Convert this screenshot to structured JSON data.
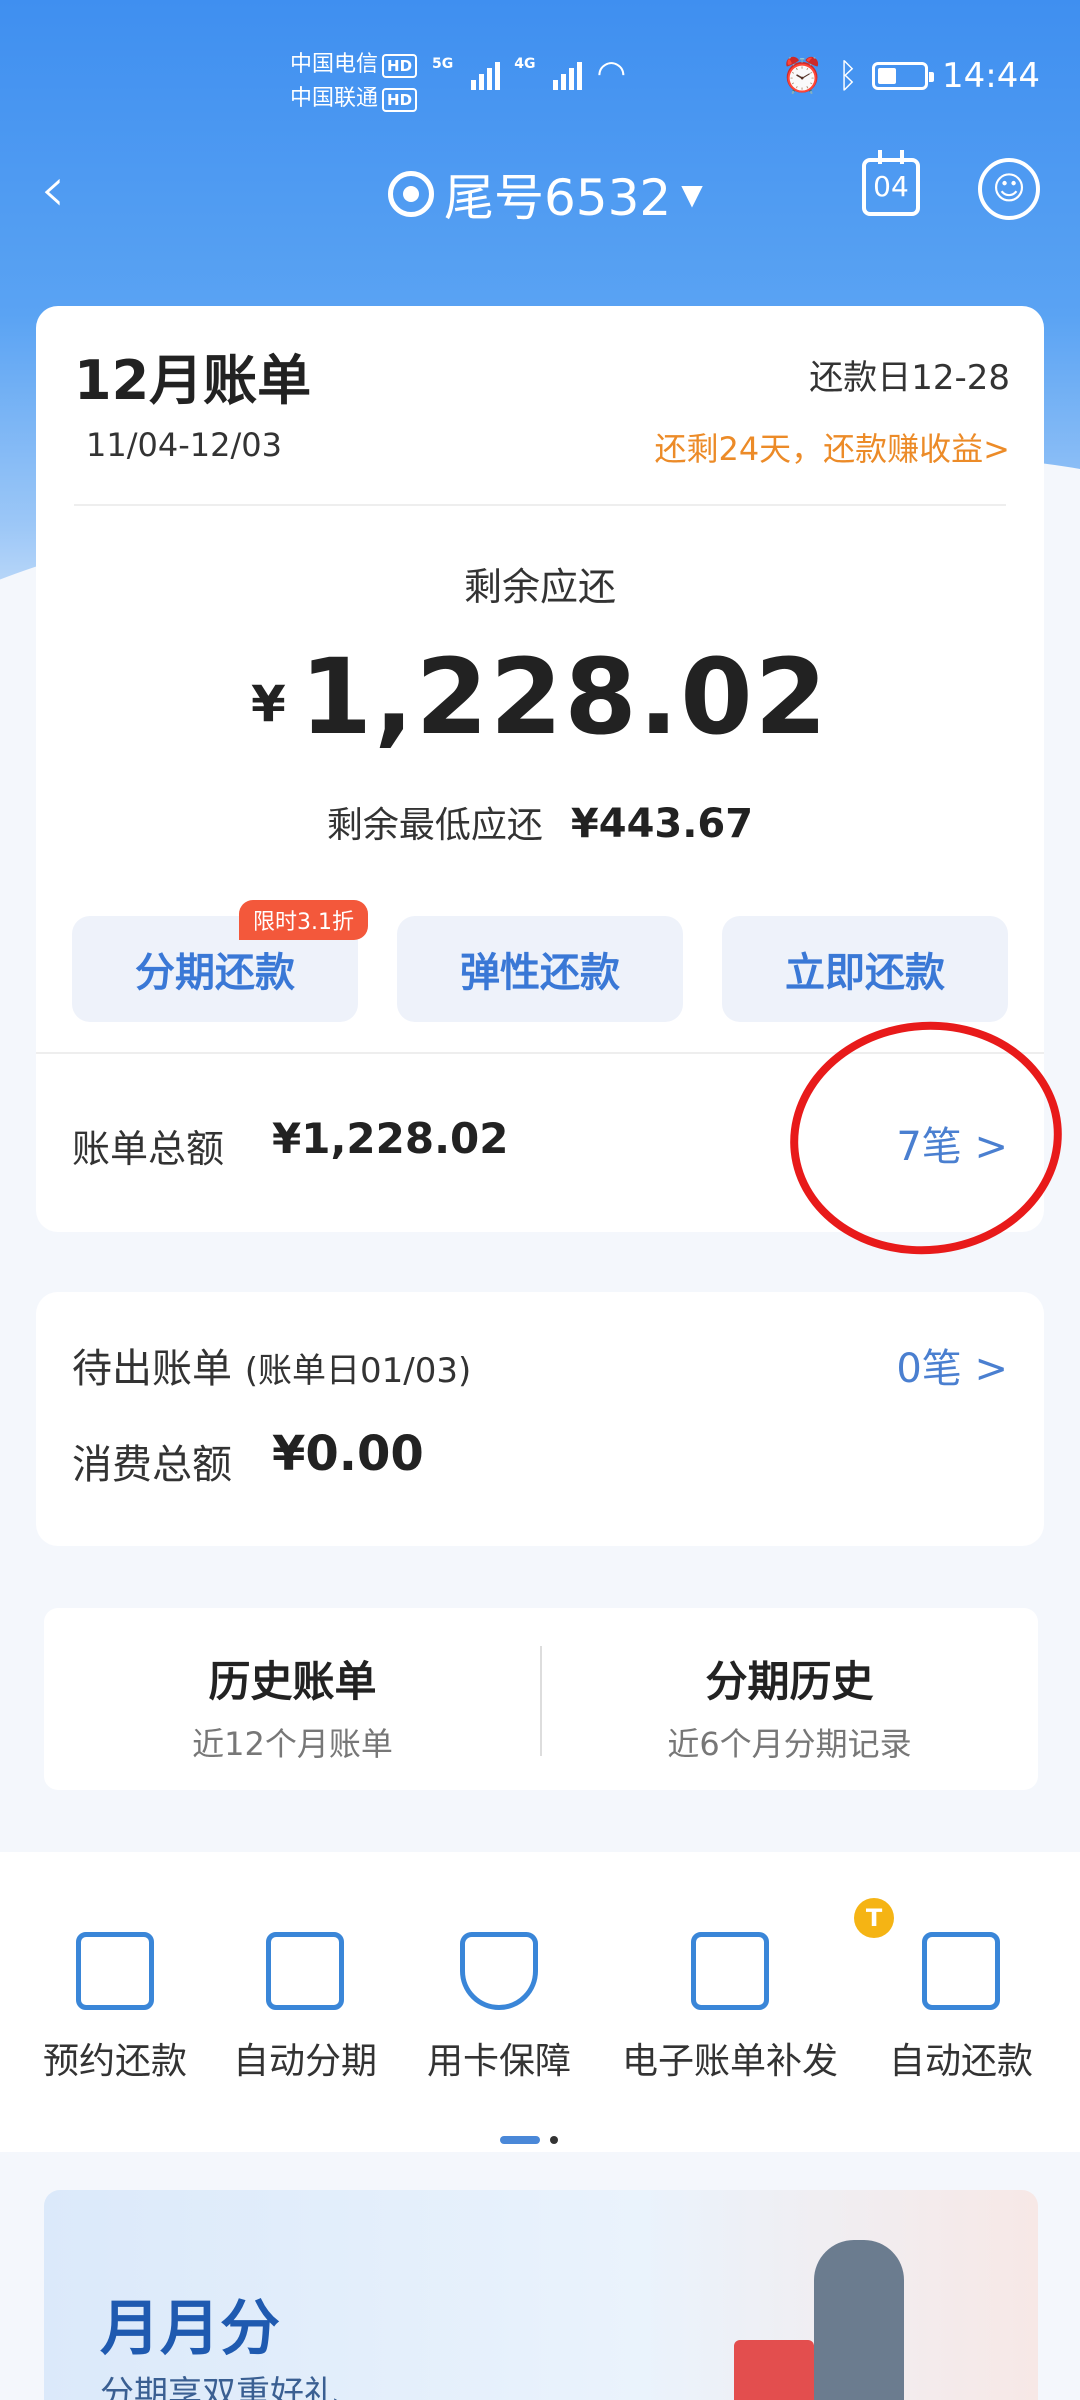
{
  "status_bar": {
    "carrier_1": "中国电信",
    "carrier_2": "中国联通",
    "hd_label": "HD",
    "net_1": "5G",
    "net_2": "4G",
    "time": "14:44"
  },
  "nav": {
    "card_name": "尾号6532",
    "calendar_day": "04"
  },
  "bill": {
    "title": "12月账单",
    "due_date": "还款日12-28",
    "period": "11/04-12/03",
    "promo": "还剩24天，还款赚收益>",
    "remaining_label": "剩余应还",
    "currency_symbol": "¥",
    "remaining_amount": "1,228.02",
    "min_label": "剩余最低应还",
    "min_amount": "¥443.67",
    "buttons": [
      {
        "label": "分期还款",
        "tag": "限时3.1折"
      },
      {
        "label": "弹性还款"
      },
      {
        "label": "立即还款"
      }
    ],
    "total_label": "账单总额",
    "total_amount": "¥1,228.02",
    "total_count": "7笔 >"
  },
  "pending": {
    "label": "待出账单",
    "bill_day": "(账单日01/03)",
    "count": "0笔 >",
    "consumption_label": "消费总额",
    "consumption_amount": "¥0.00"
  },
  "history": [
    {
      "title": "历史账单",
      "subtitle": "近12个月账单"
    },
    {
      "title": "分期历史",
      "subtitle": "近6个月分期记录"
    }
  ],
  "services": [
    {
      "label": "预约还款",
      "icon": "calendar-icon"
    },
    {
      "label": "自动分期",
      "icon": "card-clock-icon"
    },
    {
      "label": "用卡保障",
      "icon": "shield-check-icon"
    },
    {
      "label": "电子账单补发",
      "icon": "document-icon"
    },
    {
      "label": "自动还款",
      "icon": "card-repeat-icon"
    }
  ],
  "banner": {
    "title": "月月分",
    "subtitle": "分期享双重好礼"
  },
  "watermark": "T",
  "colors": {
    "primary_blue": "#3f8ff0",
    "link_blue": "#4a7fd0",
    "promo_orange": "#ec8b28",
    "annotation_red": "#e81a1a"
  }
}
